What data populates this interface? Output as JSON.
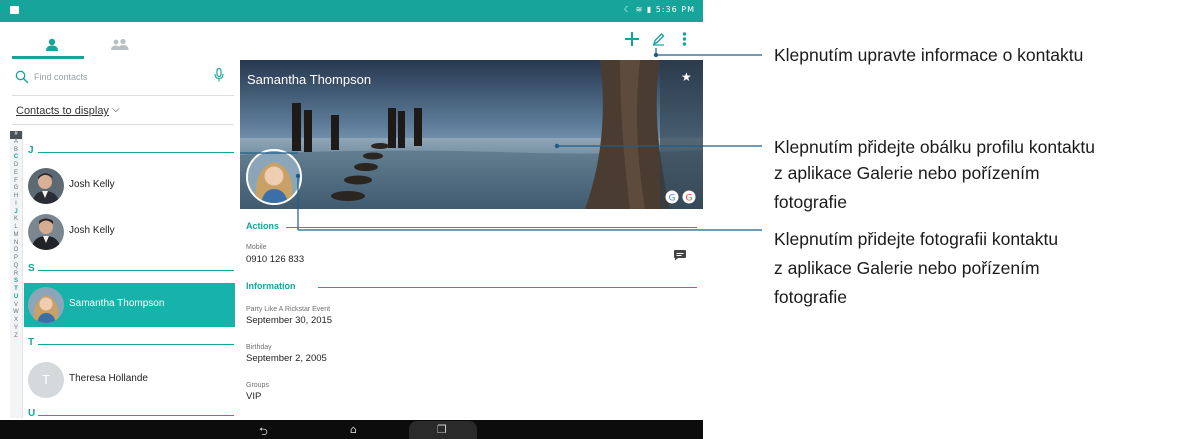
{
  "status_bar": {
    "time": "5:36 PM"
  },
  "toolbar": {
    "add_icon": "plus-icon",
    "edit_icon": "pencil-icon",
    "more_icon": "more-vert-icon"
  },
  "tabs": [
    {
      "icon": "person-icon"
    },
    {
      "icon": "groups-icon"
    }
  ],
  "search": {
    "placeholder": "Find contacts"
  },
  "filter": {
    "label": "Contacts to display"
  },
  "alphabet": [
    "#",
    "A",
    "B",
    "C",
    "D",
    "E",
    "F",
    "G",
    "H",
    "I",
    "J",
    "K",
    "L",
    "M",
    "N",
    "O",
    "P",
    "Q",
    "R",
    "S",
    "T",
    "U",
    "V",
    "W",
    "X",
    "Y",
    "Z"
  ],
  "alphabet_active": [
    "C",
    "J",
    "S",
    "T",
    "U"
  ],
  "sections": [
    {
      "letter": "J"
    },
    {
      "letter": "S"
    },
    {
      "letter": "T"
    },
    {
      "letter": "U"
    }
  ],
  "contacts": [
    {
      "name": "Josh Kelly"
    },
    {
      "name": "Josh Kelly"
    },
    {
      "name": "Samantha Thompson",
      "selected": true
    },
    {
      "name": "Theresa Hollande",
      "initial": "T"
    }
  ],
  "detail": {
    "name": "Samantha Thompson",
    "actions_heading": "Actions",
    "mobile_label": "Mobile",
    "mobile_value": "0910 126 833",
    "information_heading": "Information",
    "event_label": "Party Like A Rickstar Event",
    "event_value": "September 30, 2015",
    "birthday_label": "Birthday",
    "birthday_value": "September 2, 2005",
    "groups_label": "Groups",
    "groups_value": "VIP"
  },
  "callouts": {
    "edit": "Klepnutím upravte informace o kontaktu",
    "cover_line1": "Klepnutím přidejte obálku profilu kontaktu",
    "cover_line2": "z aplikace Galerie nebo pořízením",
    "cover_line3": "fotografie",
    "photo_line1": "Klepnutím přidejte fotografii kontaktu",
    "photo_line2": "z aplikace Galerie nebo pořízením",
    "photo_line3": "fotografie"
  },
  "colors": {
    "accent": "#17a49a",
    "selected_row": "#15b3aa"
  }
}
